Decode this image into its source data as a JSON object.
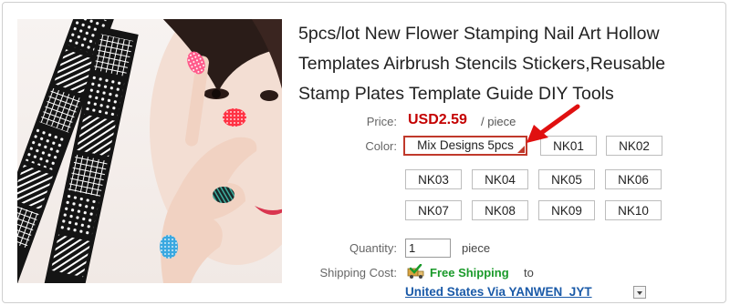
{
  "product": {
    "title": "5pcs/lot New Flower Stamping Nail Art Hollow Templates Airbrush Stencils Stickers,Reusable Stamp Plates Template Guide DIY Tools",
    "image_icon": "product-photo"
  },
  "price": {
    "label": "Price:",
    "value": "USD2.59",
    "unit": "/ piece"
  },
  "color": {
    "label": "Color:",
    "selected": "Mix Designs 5pcs",
    "options": [
      "Mix Designs 5pcs",
      "NK01",
      "NK02",
      "NK03",
      "NK04",
      "NK05",
      "NK06",
      "NK07",
      "NK08",
      "NK09",
      "NK10"
    ]
  },
  "quantity": {
    "label": "Quantity:",
    "value": "1",
    "unit": "piece"
  },
  "shipping": {
    "label": "Shipping Cost:",
    "badge_icon": "truck-check-icon",
    "free_text": "Free Shipping",
    "to_text": "to",
    "method": "United States Via YANWEN_JYT",
    "dropdown_icon": "chevron-down-icon"
  },
  "colors": {
    "price": "#c40000",
    "free_shipping": "#1a9a2a",
    "link": "#1a5aa8",
    "selected_border": "#c0392b",
    "annotation_arrow": "#e01010"
  }
}
